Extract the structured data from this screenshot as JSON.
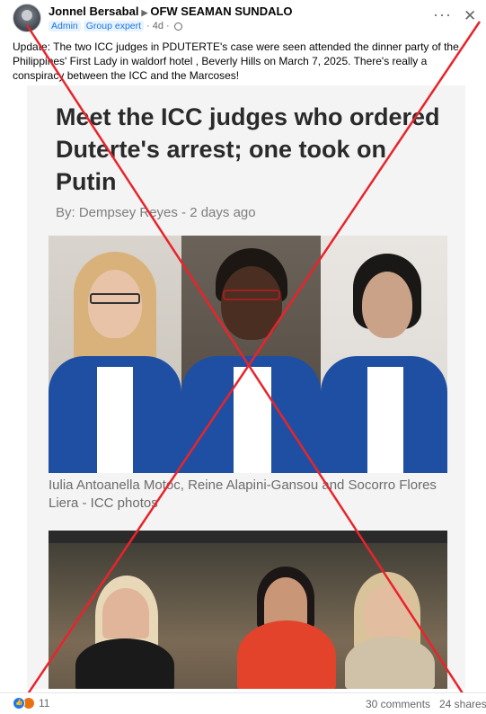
{
  "post": {
    "author": "Jonnel Bersabal",
    "separator_icon": "triangle-right-icon",
    "group": "OFW SEAMAN SUNDALO",
    "badges": [
      "Admin",
      "Group expert"
    ],
    "time": "4d",
    "dot": "·",
    "caption": "Update: The two ICC judges in PDUTERTE's case were seen attended  the dinner party of the Philippines' First Lady  in waldorf hotel , Beverly Hills on March 7, 2025. There's really a conspiracy between  the ICC and the  Marcoses!"
  },
  "article": {
    "headline": "Meet the ICC judges who ordered Duterte's arrest; one took on Putin",
    "byline": "By: Dempsey Reyes - 2 days ago",
    "photo_caption": "Iulia Antoanella Motoc, Reine Alapini-Gansou and Socorro Flores Liera - ICC photos"
  },
  "footer": {
    "reaction_icons": [
      "like-icon",
      "angry-icon"
    ],
    "reaction_count": "11",
    "comments": "30 comments",
    "shares": "24 shares"
  },
  "colors": {
    "overlay_x": "#e8242b",
    "robe_blue": "#1f4fa3",
    "badge_blue": "#1b74e4"
  }
}
